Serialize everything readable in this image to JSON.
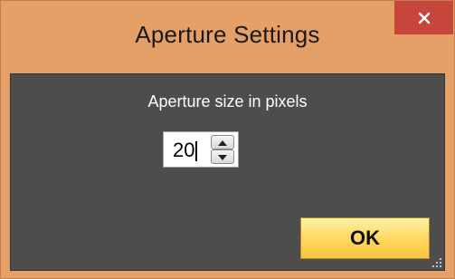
{
  "window": {
    "title": "Aperture Settings",
    "close_icon": "close-icon"
  },
  "aperture": {
    "label": "Aperture size in pixels",
    "value": "20"
  },
  "buttons": {
    "ok_label": "OK"
  },
  "colors": {
    "frame": "#e5a068",
    "close": "#c7463b",
    "client_bg": "#4d4d4d",
    "ok_button": "#ffd55c"
  }
}
